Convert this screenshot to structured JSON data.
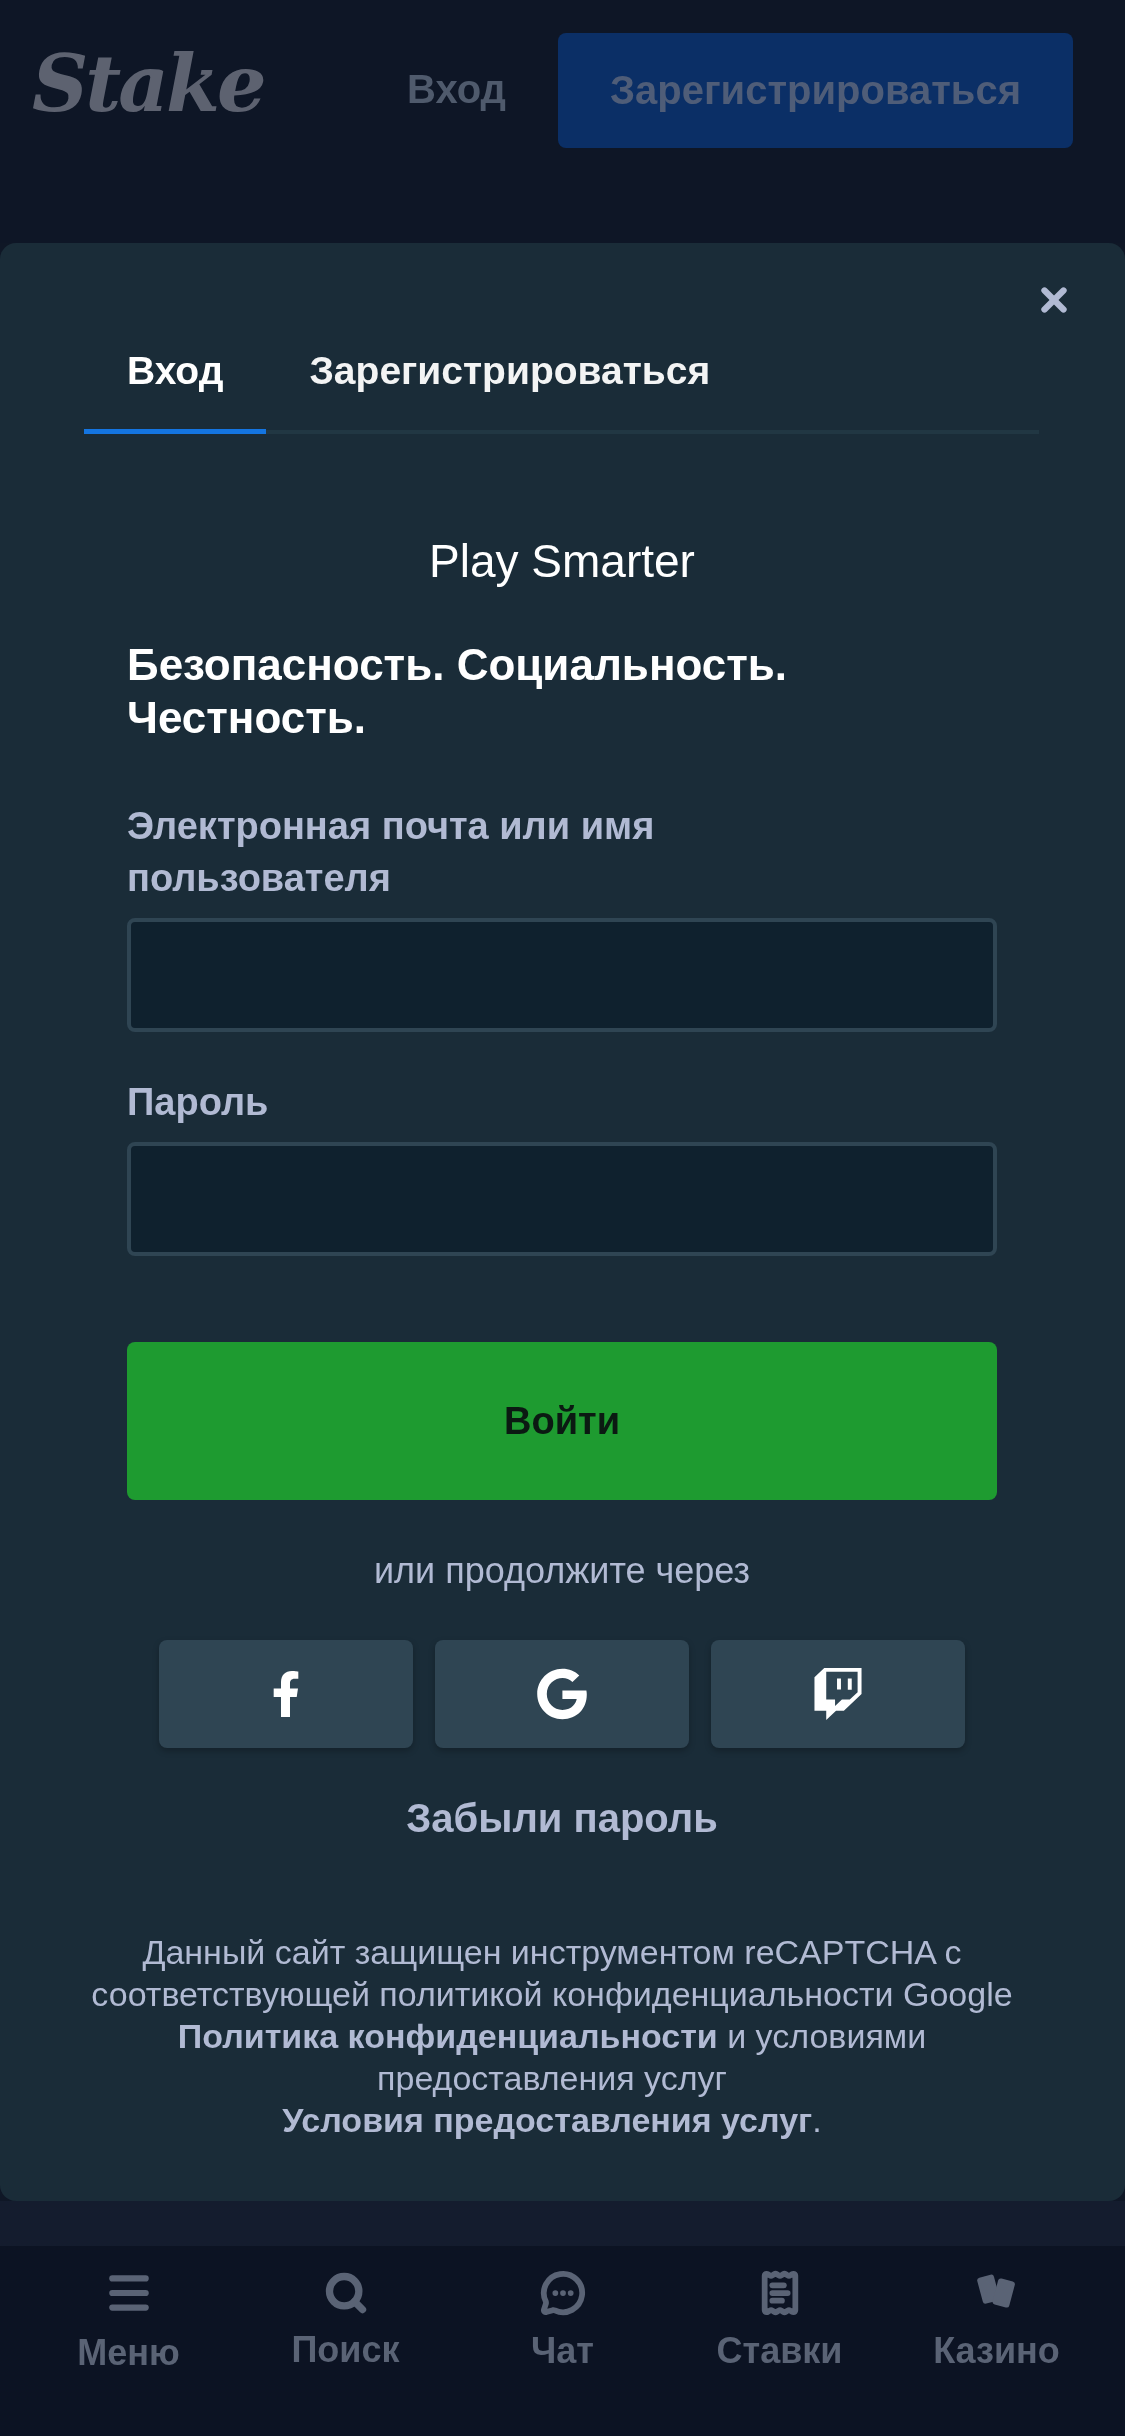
{
  "header": {
    "logo": "Stake",
    "login_link": "Вход",
    "register_button": "Зарегистрироваться"
  },
  "modal": {
    "tabs": [
      {
        "label": "Вход",
        "selected": true
      },
      {
        "label": "Зарегистрироваться",
        "selected": false
      }
    ],
    "title": "Play Smarter",
    "subtitle": "Безопасность. Социальность. Честность.",
    "fields": [
      {
        "label": "Электронная почта или имя пользователя"
      },
      {
        "label": "Пароль"
      }
    ],
    "submit_button": "Войти",
    "divider_text": "или продолжите через",
    "social_buttons": [
      {
        "kind": "facebook"
      },
      {
        "kind": "google"
      },
      {
        "kind": "twitch"
      }
    ],
    "forgot_link": "Забыли пароль",
    "footer": {
      "text_before": "Данный сайт защищен инструментом reCAPTCHA с соответствующей политикой конфиденциальности Google ",
      "privacy_link": "Политика конфиденциальности",
      "text_middle": " и условиями предоставления услуг ",
      "terms_link": "Условия предоставления услуг",
      "text_after": "."
    }
  },
  "bottom_nav": [
    {
      "label": "Меню",
      "kind": "menu"
    },
    {
      "label": "Поиск",
      "kind": "search"
    },
    {
      "label": "Чат",
      "kind": "chat"
    },
    {
      "label": "Ставки",
      "kind": "bets"
    },
    {
      "label": "Казино",
      "kind": "casino"
    }
  ]
}
